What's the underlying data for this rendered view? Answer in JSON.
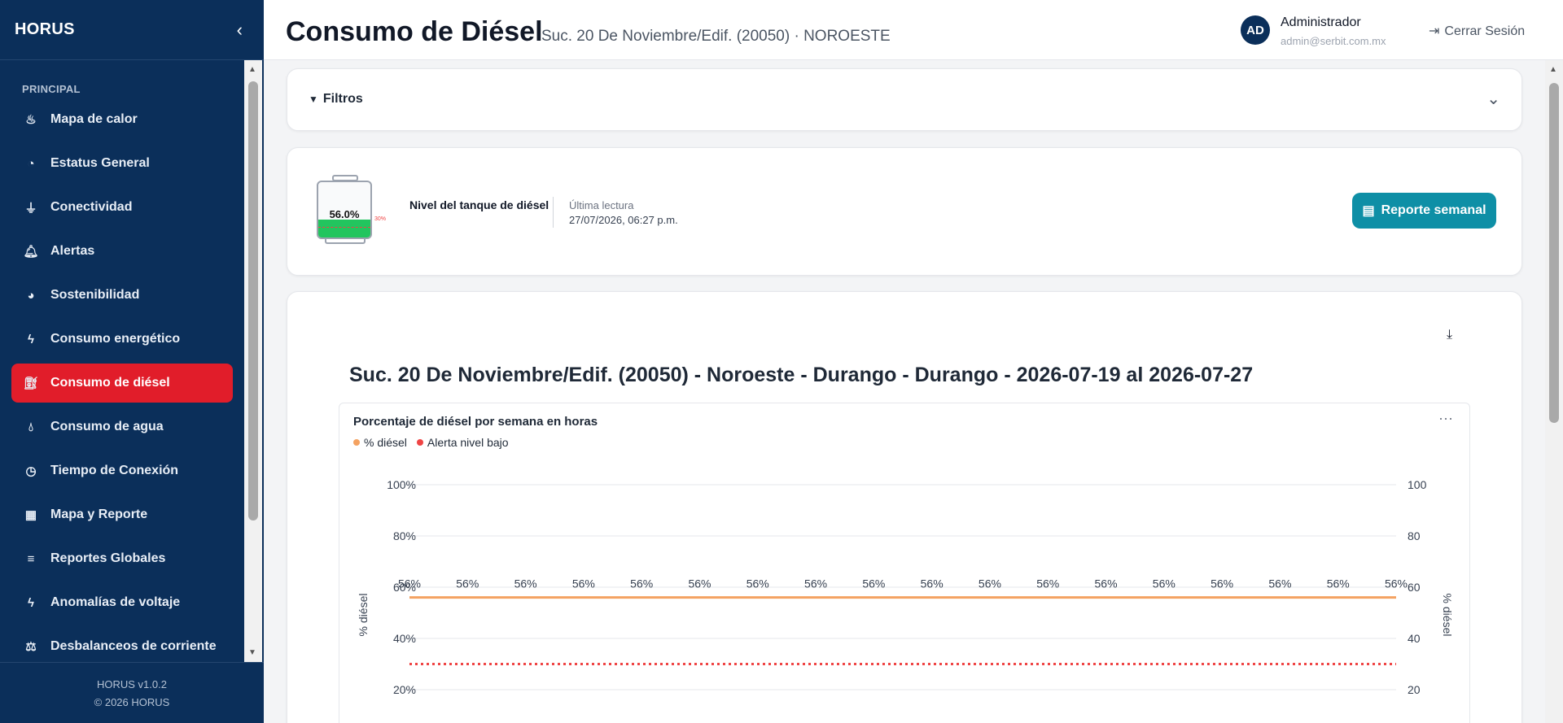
{
  "sidebar": {
    "brand": "HORUS",
    "section": "PRINCIPAL",
    "items": [
      {
        "label": "Mapa de calor",
        "icon": "fire-icon"
      },
      {
        "label": "Estatus General",
        "icon": "gauge-icon"
      },
      {
        "label": "Conectividad",
        "icon": "plug-icon"
      },
      {
        "label": "Alertas",
        "icon": "bell-icon"
      },
      {
        "label": "Sostenibilidad",
        "icon": "pie-chart-icon"
      },
      {
        "label": "Consumo energético",
        "icon": "bolt-icon"
      },
      {
        "label": "Consumo de diésel",
        "icon": "fuel-pump-icon",
        "active": true
      },
      {
        "label": "Consumo de agua",
        "icon": "droplet-icon"
      },
      {
        "label": "Tiempo de Conexión",
        "icon": "clock-icon"
      },
      {
        "label": "Mapa y Reporte",
        "icon": "map-icon"
      },
      {
        "label": "Reportes Globales",
        "icon": "bar-list-icon"
      },
      {
        "label": "Anomalías de voltaje",
        "icon": "bolt-icon"
      },
      {
        "label": "Desbalanceos de corriente",
        "icon": "scale-icon"
      }
    ],
    "version": "HORUS v1.0.2",
    "copyright": "© 2026 HORUS"
  },
  "header": {
    "title": "Consumo de Diésel",
    "subtitle": "Suc. 20 De Noviembre/Edif. (20050) · NOROESTE",
    "avatar": "AD",
    "user_name": "Administrador",
    "user_email": "admin@serbit.com.mx",
    "logout": "Cerrar Sesión"
  },
  "filters": {
    "label": "Filtros"
  },
  "tank": {
    "level_pct": 56.0,
    "level_text": "56.0%",
    "alert_pct": 30,
    "alert_text": "30%",
    "label": "Nivel del tanque de diésel",
    "last_reading_label": "Última lectura",
    "last_reading_value": "27/07/2026, 06:27 p.m.",
    "report_button": "Reporte semanal"
  },
  "chart": {
    "title": "Suc. 20 De Noviembre/Edif. (20050) - Noroeste - Durango - Durango - 2026-07-19 al 2026-07-27",
    "inner_title": "Porcentaje de diésel por semana en horas",
    "legend": [
      {
        "name": "% diésel",
        "color": "#f4a261"
      },
      {
        "name": "Alerta nivel bajo",
        "color": "#ef4444"
      }
    ]
  },
  "chart_data": {
    "type": "line",
    "ylabel": "% diésel",
    "ylabel_right": "% diésel",
    "y_ticks_left": [
      "100%",
      "80%",
      "60%",
      "40%",
      "20%"
    ],
    "y_ticks_right": [
      "100",
      "80",
      "60",
      "40",
      "20"
    ],
    "ylim": [
      0,
      100
    ],
    "grid": true,
    "legend_position": "top-left",
    "series": [
      {
        "name": "% diésel",
        "color": "#f4a261",
        "values": [
          56,
          56,
          56,
          56,
          56,
          56,
          56,
          56,
          56,
          56,
          56,
          56,
          56,
          56,
          56,
          56,
          56,
          56
        ],
        "labels": [
          "56%",
          "56%",
          "56%",
          "56%",
          "56%",
          "56%",
          "56%",
          "56%",
          "56%",
          "56%",
          "56%",
          "56%",
          "56%",
          "56%",
          "56%",
          "56%",
          "56%",
          "56%"
        ]
      },
      {
        "name": "Alerta nivel bajo",
        "color": "#ef4444",
        "values": [
          30,
          30,
          30,
          30,
          30,
          30,
          30,
          30,
          30,
          30,
          30,
          30,
          30,
          30,
          30,
          30,
          30,
          30
        ],
        "style": "dotted"
      }
    ]
  }
}
